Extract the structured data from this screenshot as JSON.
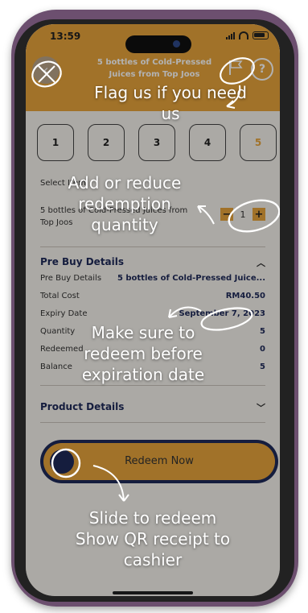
{
  "status_bar": {
    "time": "13:59"
  },
  "header": {
    "title": "5 bottles of Cold-Pressed Juices from Top Joos",
    "help_icon": "?"
  },
  "steps": [
    "1",
    "2",
    "3",
    "4",
    "5"
  ],
  "select_label": "Select Item",
  "item": {
    "name": "5 bottles of Cold-Pressed Juices from Top Joos",
    "quantity": "1",
    "minus": "−",
    "plus": "+"
  },
  "pre_buy": {
    "heading": "Pre Buy Details",
    "rows": [
      {
        "label": "Pre Buy Details",
        "value": "5 bottles of Cold-Pressed Juice..."
      },
      {
        "label": "Total Cost",
        "value": "RM40.50"
      },
      {
        "label": "Expiry Date",
        "value": "September 7, 2023"
      },
      {
        "label": "Quantity",
        "value": "5"
      },
      {
        "label": "Redeemed",
        "value": "0"
      },
      {
        "label": "Balance",
        "value": "5"
      }
    ]
  },
  "product_details": {
    "heading": "Product Details"
  },
  "slider": {
    "label": "Redeem Now"
  },
  "annotations": {
    "flag": "Flag us if you need us",
    "quantity": "Add or reduce redemption quantity",
    "expiry": "Make sure to redeem before expiration date",
    "slide": "Slide to redeem Show QR receipt to cashier"
  },
  "colors": {
    "accent": "#e7a43c",
    "navy": "#1f2a5a",
    "frame": "#6c4f6f"
  }
}
